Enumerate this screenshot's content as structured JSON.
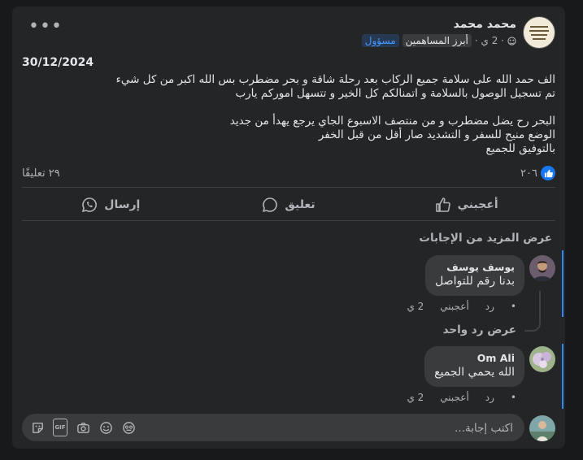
{
  "post": {
    "author": "محمد محمد",
    "admin_badge": "مسؤول",
    "top_contributor_badge": "أبرز المساهمين",
    "time": "· 2 ي ·",
    "date": "30/12/2024",
    "lines": [
      "الف حمد الله على سلامة جميع  الركاب بعد رحلة شاقة و بحر مضطرب بس الله اكبر من كل شيء",
      "تم تسجيل الوصول بالسلامة و اتمنالكم كل الخير و تتسهل اموركم يارب",
      "",
      "البحر رح يضل مضطرب و من منتصف الاسبوع الجاي يرجع يهدأ من جديد",
      "الوضع منيح للسفر و التشديد صار أقل من قبل الخفر",
      "بالتوفيق للجميع"
    ],
    "reactions_count": "٢٠٦",
    "comments_count": "٢٩ تعليقًا"
  },
  "actions": {
    "like": "أعجبني",
    "comment": "تعليق",
    "send": "إرسال"
  },
  "view_more_replies": "عرض المزيد من الإجابات",
  "comments": [
    {
      "name": "يوسف يوسف",
      "text": "بدنا رقم للتواصل",
      "time": "2 ي",
      "like": "أعجبني",
      "reply": "رد",
      "dot": "•"
    },
    {
      "name": "Om Ali",
      "text": "الله يحمي الجميع",
      "time": "2 ي",
      "like": "أعجبني",
      "reply": "رد",
      "dot": "•"
    }
  ],
  "view_one_reply": "عرض رد واحد",
  "reply_box": {
    "placeholder": "اكتب إجابة...",
    "gif_label": "GIF"
  },
  "colors": {
    "background": "#18191a",
    "card": "#242526",
    "accent": "#2d88ff",
    "like_blue": "#1877f2"
  }
}
